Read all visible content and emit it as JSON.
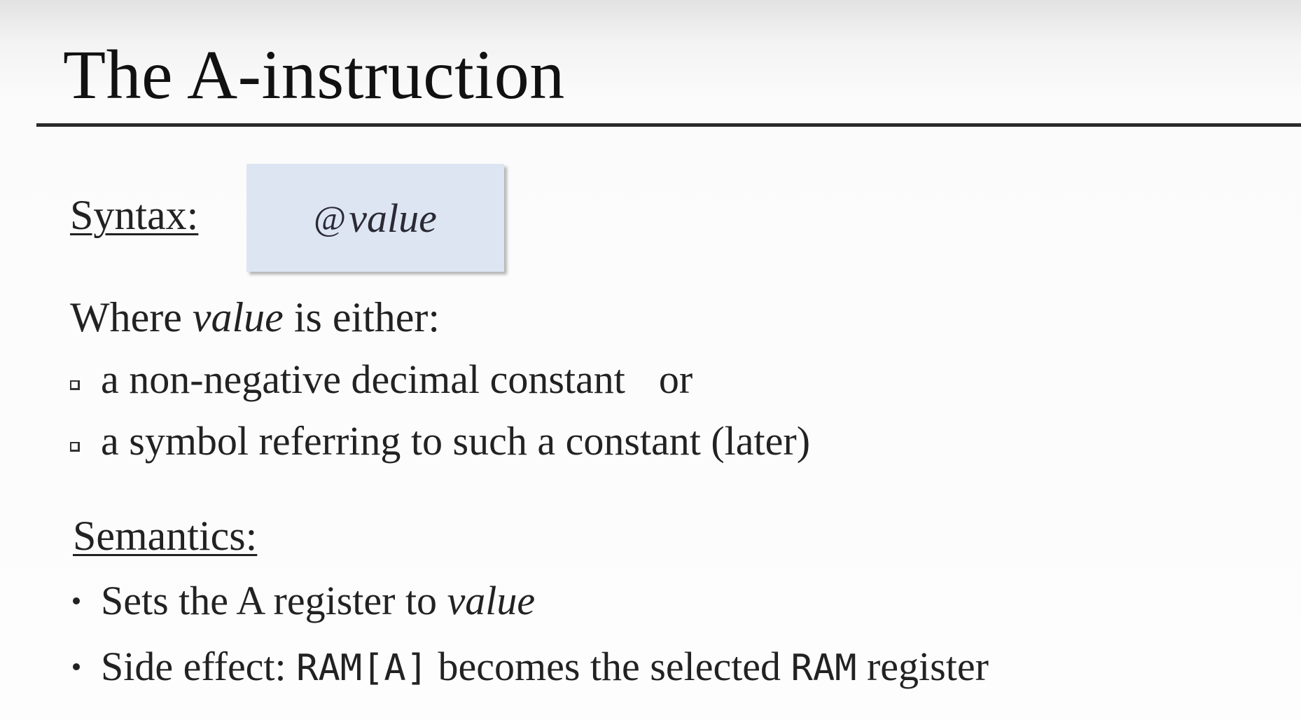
{
  "slide": {
    "title": "The A-instruction"
  },
  "syntax": {
    "label": "Syntax:",
    "at_sign": "@",
    "value_word": "value"
  },
  "where": {
    "prefix": "Where ",
    "value_word": "value",
    "suffix": " is either:"
  },
  "options": {
    "first_text": "a non-negative decimal constant",
    "first_or": "or",
    "second_text": "a symbol referring to such a constant (later)"
  },
  "semantics": {
    "label": "Semantics:",
    "item1_prefix": "Sets the A register to ",
    "item1_value": "value",
    "item2_prefix": "Side effect: ",
    "item2_code1": "RAM[A]",
    "item2_middle": " becomes the selected ",
    "item2_code2": "RAM",
    "item2_suffix": " register"
  }
}
